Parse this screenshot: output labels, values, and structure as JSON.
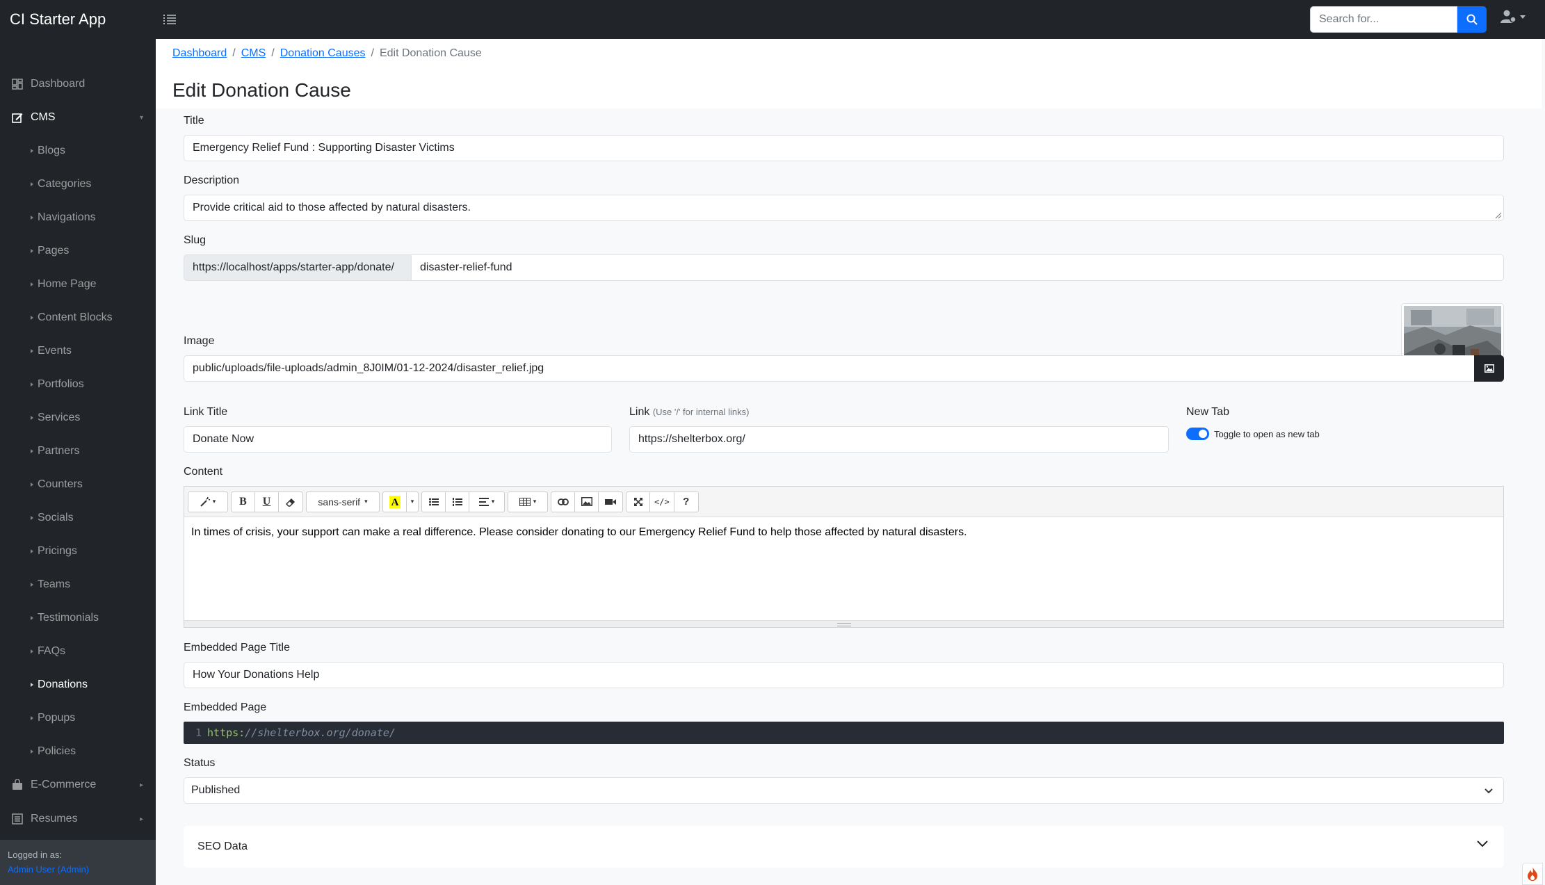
{
  "app": {
    "brand": "CI Starter App"
  },
  "topbar": {
    "search_placeholder": "Search for..."
  },
  "sidebar": {
    "dashboard": "Dashboard",
    "cms": "CMS",
    "cms_items": [
      "Blogs",
      "Categories",
      "Navigations",
      "Pages",
      "Home Page",
      "Content Blocks",
      "Events",
      "Portfolios",
      "Services",
      "Partners",
      "Counters",
      "Socials",
      "Pricings",
      "Teams",
      "Testimonials",
      "FAQs",
      "Donations",
      "Popups",
      "Policies"
    ],
    "active_item": "Donations",
    "ecommerce": "E-Commerce",
    "resumes": "Resumes",
    "footer_label": "Logged in as:",
    "footer_user": "Admin User (Admin)"
  },
  "breadcrumb": {
    "items": [
      "Dashboard",
      "CMS",
      "Donation Causes"
    ],
    "current": "Edit Donation Cause"
  },
  "page_title": "Edit Donation Cause",
  "form": {
    "title_label": "Title",
    "title_value": "Emergency Relief Fund : Supporting Disaster Victims",
    "description_label": "Description",
    "description_value": "Provide critical aid to those affected by natural disasters.",
    "slug_label": "Slug",
    "slug_prefix": "https://localhost/apps/starter-app/donate/",
    "slug_value": "disaster-relief-fund",
    "image_label": "Image",
    "image_value": "public/uploads/file-uploads/admin_8J0IM/01-12-2024/disaster_relief.jpg",
    "link_title_label": "Link Title",
    "link_title_value": "Donate Now",
    "link_label": "Link",
    "link_hint": "(Use '/' for internal links)",
    "link_value": "https://shelterbox.org/",
    "new_tab_label": "New Tab",
    "new_tab_toggle": "Toggle to open as new tab",
    "new_tab_on": true,
    "content_label": "Content",
    "editor_font": "sans-serif",
    "content_value": "In times of crisis, your support can make a real difference. Please consider donating to our Emergency Relief Fund to help those affected by natural disasters.",
    "embedded_title_label": "Embedded Page Title",
    "embedded_title_value": "How Your Donations Help",
    "embedded_page_label": "Embedded Page",
    "embedded_line_no": "1",
    "embedded_scheme": "https:",
    "embedded_rest": "//shelterbox.org/donate/",
    "status_label": "Status",
    "status_value": "Published",
    "seo_label": "SEO Data"
  },
  "colors": {
    "primary": "#0d6efd",
    "dark": "#212529",
    "panel": "#f8f9fa"
  }
}
